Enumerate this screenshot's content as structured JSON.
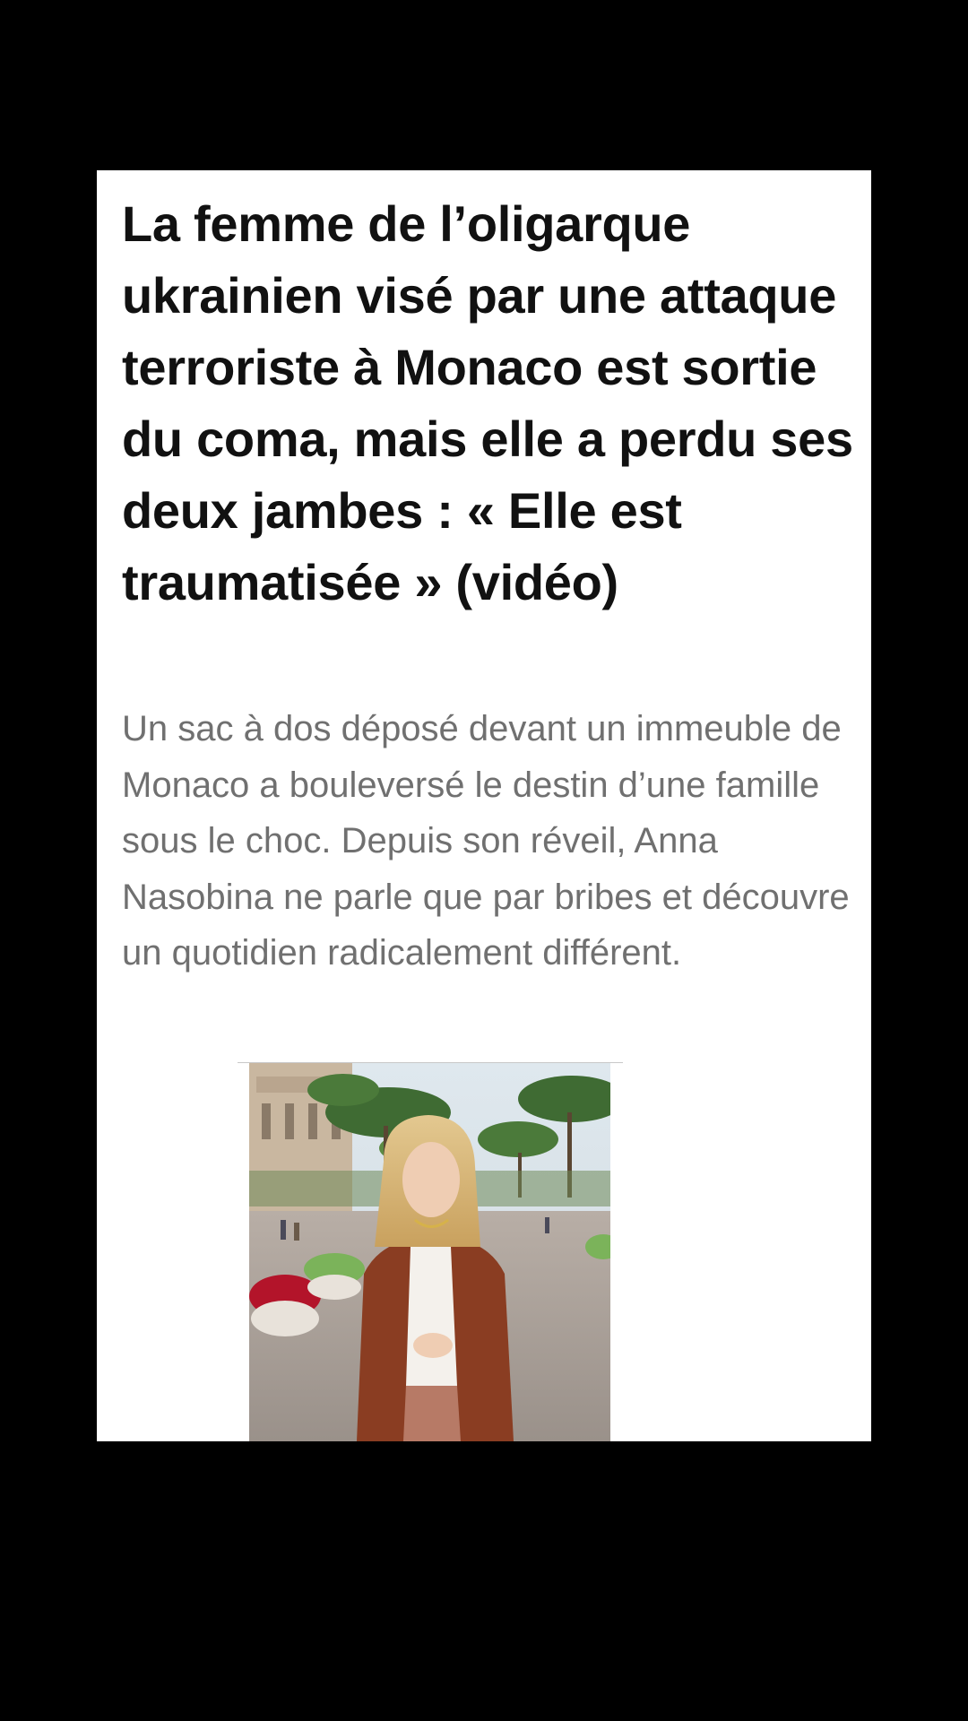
{
  "article": {
    "headline": "La femme de l’oligarque ukrainien visé par une attaque terroriste à Monaco est sortie du coma, mais elle a perdu ses deux jambes : « Elle est traumatisée » (vidéo)",
    "lede": "Un sac à dos déposé devant un immeuble de Monaco a bouleversé le destin d’une famille sous le choc. Depuis son réveil, Anna Nasobina ne parle que par bribes et découvre un quotidien radicalement différent.",
    "photo_subject": "woman-in-rust-blazer-on-city-street"
  },
  "colors": {
    "page_background": "#000000",
    "card_background": "#ffffff",
    "headline_text": "#111111",
    "lede_text": "#707070"
  }
}
